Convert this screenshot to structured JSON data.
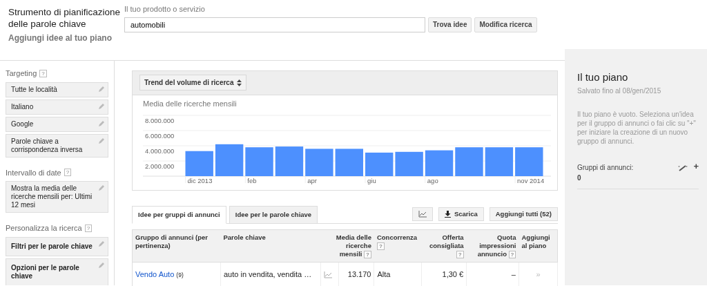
{
  "header": {
    "title": "Strumento di pianificazione delle parole chiave",
    "subtitle": "Aggiungi idee al tuo piano"
  },
  "search": {
    "label": "Il tuo prodotto o servizio",
    "value": "automobili",
    "buttons": [
      "Trova idee",
      "Modifica ricerca"
    ]
  },
  "sidebar": [
    {
      "title": "Targeting",
      "help": "?",
      "items": [
        {
          "kind": "value",
          "text": "Tutte le località"
        },
        {
          "kind": "value",
          "text": "Italiano"
        },
        {
          "kind": "value",
          "text": "Google"
        },
        {
          "kind": "value",
          "text": "Parole chiave a corrispondenza inversa"
        }
      ]
    },
    {
      "title": "Intervallo di date",
      "help": "?",
      "items": [
        {
          "kind": "value",
          "text": "Mostra la media delle ricerche mensili per: Ultimi 12 mesi"
        }
      ]
    },
    {
      "title": "Personalizza la ricerca",
      "help": "?",
      "items": [
        {
          "kind": "heading",
          "text": "Filtri per le parole chiave"
        },
        {
          "kind": "heading",
          "text": "Opzioni per le parole chiave"
        }
      ]
    }
  ],
  "trend": {
    "selector": "Trend del volume di ricerca",
    "chart_data": {
      "type": "bar",
      "title": "Media delle ricerche mensili",
      "categories": [
        "dic 2013",
        null,
        "feb",
        null,
        "apr",
        null,
        "giu",
        null,
        "ago",
        null,
        null,
        "nov 2014"
      ],
      "series": [
        {
          "color": "#4d90fe",
          "values": [
            3300000,
            4200000,
            3800000,
            3900000,
            3600000,
            3600000,
            3100000,
            3200000,
            3400000,
            3800000,
            3800000,
            3800000
          ]
        }
      ],
      "grid": true,
      "ylim": [
        0,
        8000000
      ],
      "yticks": [
        {
          "value": 2000000,
          "label": "2.000.000"
        },
        {
          "value": 4000000,
          "label": "4.000.000"
        },
        {
          "value": 6000000,
          "label": "6.000.000"
        },
        {
          "value": 8000000,
          "label": "8.000.000"
        }
      ]
    }
  },
  "tabs": [
    {
      "label": "Idee per gruppi di annunci",
      "selected": true
    },
    {
      "label": "Idee per le parole chiave",
      "selected": false
    }
  ],
  "toolbar": {
    "download": "Scarica",
    "add_all": "Aggiungi tutti (52)"
  },
  "table": {
    "columns": [
      {
        "label": "Gruppo di annunci (per pertinenza)"
      },
      {
        "label": "Parole chiave"
      },
      {
        "label": "Media delle ricerche mensili",
        "help": "?"
      },
      {
        "label": "Concorrenza",
        "help": "?"
      },
      {
        "label": "Offerta consigliata",
        "help": "?"
      },
      {
        "label": "Quota impressioni annuncio",
        "help": "?"
      },
      {
        "label": "Aggiungi al piano"
      }
    ],
    "rows": [
      {
        "group": "Vendo Auto",
        "count": "(9)",
        "keywords": "auto in vendita, vendita …",
        "searches": "13.170",
        "competition": "Alta",
        "bid": "1,30 €",
        "share": "–",
        "add": "»"
      }
    ]
  },
  "plan": {
    "title": "Il tuo piano",
    "saved": "Salvato fino al 08/gen/2015",
    "empty": "Il tuo piano è vuoto. Seleziona un'idea per il gruppo di annunci o fai clic su \"+\" per iniziare la creazione di un nuovo gruppo di annunci.",
    "groups_label": "Gruppi di annunci:",
    "groups_count": "0",
    "add": "+"
  }
}
